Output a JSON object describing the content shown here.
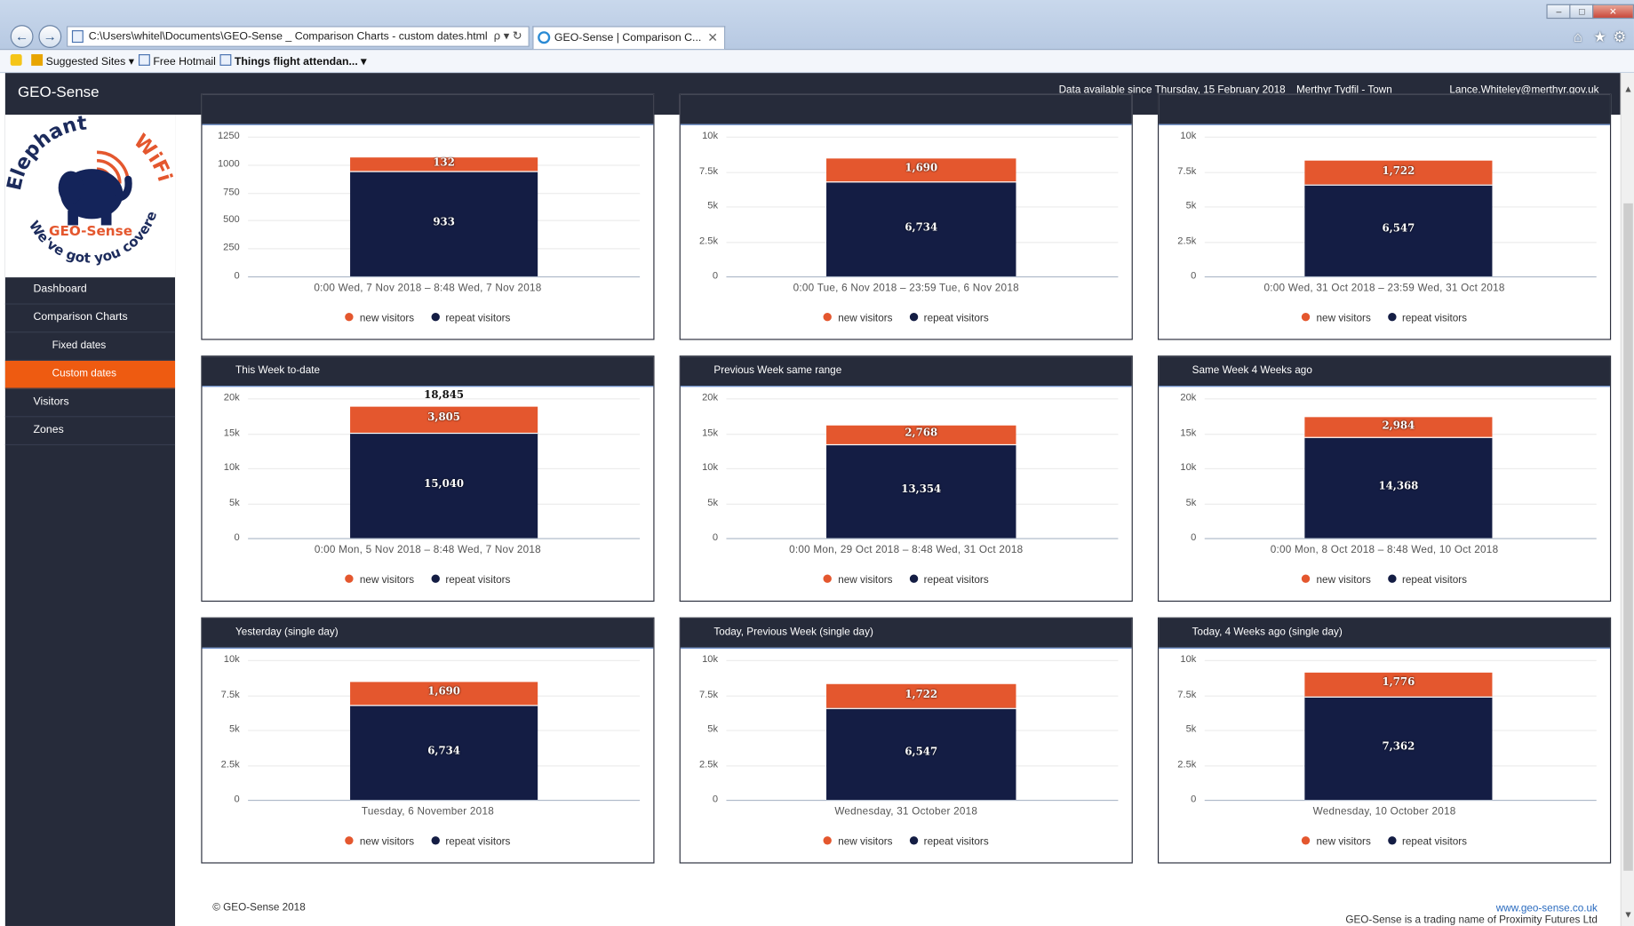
{
  "browser": {
    "address": "C:\\Users\\whitel\\Documents\\GEO-Sense _ Comparison Charts - custom dates.html",
    "address_tools": "ρ ▾ ↻",
    "tab_title": "GEO-Sense | Comparison C...",
    "favorites": [
      "Suggested Sites ▾",
      "Free Hotmail",
      "Things flight attendan... ▾"
    ]
  },
  "header": {
    "brand": "GEO-Sense",
    "data_since": "Data available since Thursday, 15 February 2018",
    "location": "Merthyr Tydfil - Town",
    "user": "Lance.Whiteley@merthyr.gov.uk"
  },
  "logo": {
    "top_text": "Elephant",
    "wifi_text": "WiFi",
    "brand_text": "GEO-Sense",
    "slogan": "We've got you covered"
  },
  "sidebar": {
    "items": [
      {
        "label": "Dashboard"
      },
      {
        "label": "Comparison Charts"
      },
      {
        "label": "Fixed dates"
      },
      {
        "label": "Custom dates"
      },
      {
        "label": "Visitors"
      },
      {
        "label": "Zones"
      }
    ]
  },
  "legend": {
    "new": "new visitors",
    "repeat": "repeat visitors"
  },
  "colors": {
    "new": "#e4572e",
    "repeat": "#141d44",
    "accent": "#ee5b11",
    "header": "#262b3a"
  },
  "chart_data": [
    {
      "type": "bar",
      "title": "",
      "ylim": [
        0,
        1250
      ],
      "yticks": [
        "0",
        "250",
        "500",
        "750",
        "1000",
        "1250"
      ],
      "categories": [
        "0:00 Wed, 7 Nov 2018 – 8:48 Wed, 7 Nov 2018"
      ],
      "series": [
        {
          "name": "new visitors",
          "values": [
            132
          ]
        },
        {
          "name": "repeat visitors",
          "values": [
            933
          ]
        }
      ],
      "total_label": ""
    },
    {
      "type": "bar",
      "title": "",
      "ylim": [
        0,
        10000
      ],
      "yticks": [
        "0",
        "2.5k",
        "5k",
        "7.5k",
        "10k"
      ],
      "categories": [
        "0:00 Tue, 6 Nov 2018 – 23:59 Tue, 6 Nov 2018"
      ],
      "series": [
        {
          "name": "new visitors",
          "values": [
            1690
          ]
        },
        {
          "name": "repeat visitors",
          "values": [
            6734
          ]
        }
      ],
      "total_label": ""
    },
    {
      "type": "bar",
      "title": "",
      "ylim": [
        0,
        10000
      ],
      "yticks": [
        "0",
        "2.5k",
        "5k",
        "7.5k",
        "10k"
      ],
      "categories": [
        "0:00 Wed, 31 Oct 2018 – 23:59 Wed, 31 Oct 2018"
      ],
      "series": [
        {
          "name": "new visitors",
          "values": [
            1722
          ]
        },
        {
          "name": "repeat visitors",
          "values": [
            6547
          ]
        }
      ],
      "total_label": ""
    },
    {
      "type": "bar",
      "title": "This Week to-date",
      "ylim": [
        0,
        20000
      ],
      "yticks": [
        "0",
        "5k",
        "10k",
        "15k",
        "20k"
      ],
      "categories": [
        "0:00 Mon, 5 Nov 2018 – 8:48 Wed, 7 Nov 2018"
      ],
      "series": [
        {
          "name": "new visitors",
          "values": [
            3805
          ]
        },
        {
          "name": "repeat visitors",
          "values": [
            15040
          ]
        }
      ],
      "total_label": "18,845"
    },
    {
      "type": "bar",
      "title": "Previous Week same range",
      "ylim": [
        0,
        20000
      ],
      "yticks": [
        "0",
        "5k",
        "10k",
        "15k",
        "20k"
      ],
      "categories": [
        "0:00 Mon, 29 Oct 2018 – 8:48 Wed, 31 Oct 2018"
      ],
      "series": [
        {
          "name": "new visitors",
          "values": [
            2768
          ]
        },
        {
          "name": "repeat visitors",
          "values": [
            13354
          ]
        }
      ],
      "total_label": ""
    },
    {
      "type": "bar",
      "title": "Same Week 4 Weeks ago",
      "ylim": [
        0,
        20000
      ],
      "yticks": [
        "0",
        "5k",
        "10k",
        "15k",
        "20k"
      ],
      "categories": [
        "0:00 Mon, 8 Oct 2018 – 8:48 Wed, 10 Oct 2018"
      ],
      "series": [
        {
          "name": "new visitors",
          "values": [
            2984
          ]
        },
        {
          "name": "repeat visitors",
          "values": [
            14368
          ]
        }
      ],
      "total_label": ""
    },
    {
      "type": "bar",
      "title": "Yesterday (single day)",
      "ylim": [
        0,
        10000
      ],
      "yticks": [
        "0",
        "2.5k",
        "5k",
        "7.5k",
        "10k"
      ],
      "categories": [
        "Tuesday, 6 November 2018"
      ],
      "series": [
        {
          "name": "new visitors",
          "values": [
            1690
          ]
        },
        {
          "name": "repeat visitors",
          "values": [
            6734
          ]
        }
      ],
      "total_label": ""
    },
    {
      "type": "bar",
      "title": "Today, Previous Week (single day)",
      "ylim": [
        0,
        10000
      ],
      "yticks": [
        "0",
        "2.5k",
        "5k",
        "7.5k",
        "10k"
      ],
      "categories": [
        "Wednesday, 31 October 2018"
      ],
      "series": [
        {
          "name": "new visitors",
          "values": [
            1722
          ]
        },
        {
          "name": "repeat visitors",
          "values": [
            6547
          ]
        }
      ],
      "total_label": ""
    },
    {
      "type": "bar",
      "title": "Today, 4 Weeks ago (single day)",
      "ylim": [
        0,
        10000
      ],
      "yticks": [
        "0",
        "2.5k",
        "5k",
        "7.5k",
        "10k"
      ],
      "categories": [
        "Wednesday, 10 October 2018"
      ],
      "series": [
        {
          "name": "new visitors",
          "values": [
            1776
          ]
        },
        {
          "name": "repeat visitors",
          "values": [
            7362
          ]
        }
      ],
      "total_label": ""
    }
  ],
  "footer": {
    "copyright": "© GEO-Sense 2018",
    "link": "www.geo-sense.co.uk",
    "trading": "GEO-Sense is a trading name of Proximity Futures Ltd"
  }
}
